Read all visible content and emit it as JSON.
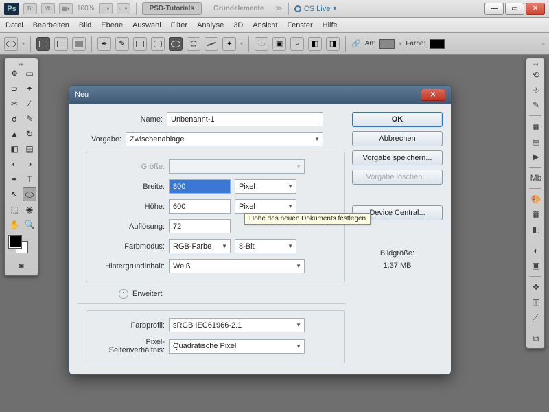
{
  "app": {
    "zoom": "100%",
    "tabs": [
      "PSD-Tutorials",
      "Grundelemente"
    ],
    "cs_live": "CS Live"
  },
  "menu": [
    "Datei",
    "Bearbeiten",
    "Bild",
    "Ebene",
    "Auswahl",
    "Filter",
    "Analyse",
    "3D",
    "Ansicht",
    "Fenster",
    "Hilfe"
  ],
  "optbar": {
    "art": "Art:",
    "farbe": "Farbe:"
  },
  "dialog": {
    "title": "Neu",
    "labels": {
      "name": "Name:",
      "vorgabe": "Vorgabe:",
      "groesse": "Größe:",
      "breite": "Breite:",
      "hoehe": "Höhe:",
      "aufloesung": "Auflösung:",
      "farbmodus": "Farbmodus:",
      "hintergrund": "Hintergrundinhalt:",
      "erweitert": "Erweitert",
      "farbprofil": "Farbprofil:",
      "pixelverh": "Pixel-Seitenverhältnis:"
    },
    "values": {
      "name": "Unbenannt-1",
      "vorgabe": "Zwischenablage",
      "breite": "800",
      "breite_unit": "Pixel",
      "hoehe": "600",
      "hoehe_unit": "Pixel",
      "aufloesung": "72",
      "farbmodus": "RGB-Farbe",
      "bittiefe": "8-Bit",
      "hintergrund": "Weiß",
      "farbprofil": "sRGB IEC61966-2.1",
      "pixelverh": "Quadratische Pixel"
    },
    "buttons": {
      "ok": "OK",
      "abbrechen": "Abbrechen",
      "speichern": "Vorgabe speichern...",
      "loeschen": "Vorgabe löschen...",
      "device": "Device Central..."
    },
    "info": {
      "label": "Bildgröße:",
      "value": "1,37 MB"
    },
    "tooltip": "Höhe des neuen Dokuments festlegen"
  }
}
